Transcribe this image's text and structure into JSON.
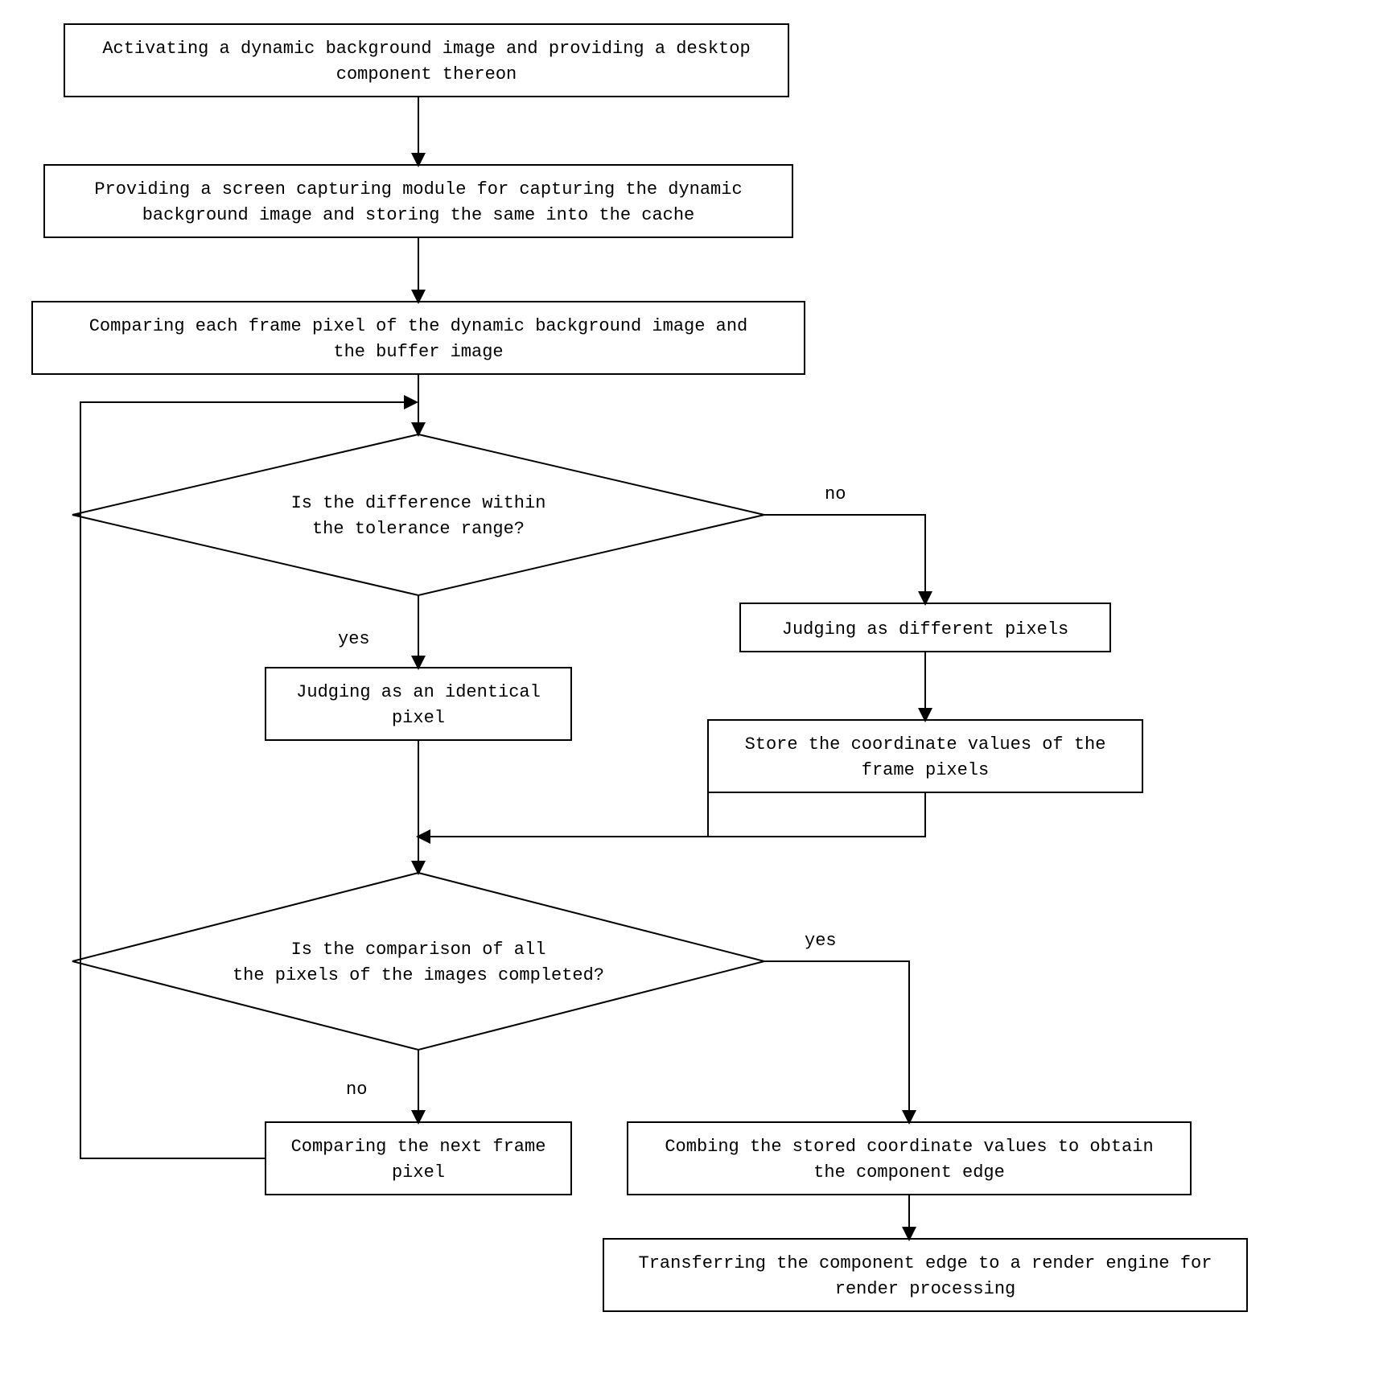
{
  "nodes": {
    "n1": {
      "l1": "Activating a dynamic background image and providing a desktop",
      "l2": "component thereon"
    },
    "n2": {
      "l1": "Providing a screen capturing module for capturing the dynamic",
      "l2": "background image and storing the same into the cache"
    },
    "n3": {
      "l1": "Comparing each frame pixel of the dynamic background image and",
      "l2": "the buffer image"
    },
    "d1": {
      "l1": "Is the difference within",
      "l2": "the tolerance range?"
    },
    "n4": {
      "l1": "Judging as an identical",
      "l2": "pixel"
    },
    "n5": {
      "l1": "Judging as different pixels"
    },
    "n6": {
      "l1": "Store the coordinate values of the",
      "l2": "frame pixels"
    },
    "d2": {
      "l1": "Is the comparison of all",
      "l2": "the pixels of the images completed?"
    },
    "n7": {
      "l1": "Comparing the next frame",
      "l2": "pixel"
    },
    "n8": {
      "l1": "Combing the stored coordinate values to obtain",
      "l2": "the component edge"
    },
    "n9": {
      "l1": "Transferring the component edge to a render engine for",
      "l2": "render processing"
    }
  },
  "labels": {
    "d1_no": "no",
    "d1_yes": "yes",
    "d2_no": "no",
    "d2_yes": "yes"
  }
}
